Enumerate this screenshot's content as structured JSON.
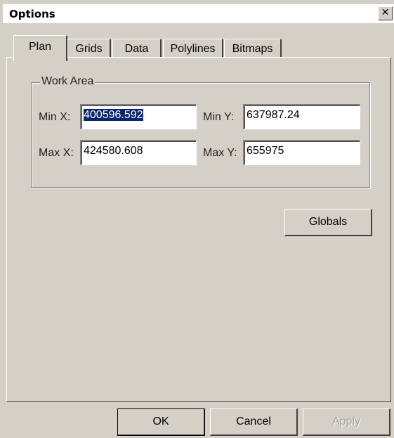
{
  "window": {
    "title": "Options",
    "close_glyph": "✕"
  },
  "tabs": [
    {
      "label": "Plan",
      "active": true
    },
    {
      "label": "Grids",
      "active": false
    },
    {
      "label": "Data",
      "active": false
    },
    {
      "label": "Polylines",
      "active": false
    },
    {
      "label": "Bitmaps",
      "active": false
    }
  ],
  "work_area": {
    "group_label": "Work Area",
    "min_x": {
      "label": "Min X:",
      "value": "400596.592"
    },
    "min_y": {
      "label": "Min Y:",
      "value": "637987.24"
    },
    "max_x": {
      "label": "Max X:",
      "value": "424580.608"
    },
    "max_y": {
      "label": "Max Y:",
      "value": "655975"
    }
  },
  "buttons": {
    "globals": "Globals",
    "ok": "OK",
    "cancel": "Cancel",
    "apply": "Apply"
  }
}
